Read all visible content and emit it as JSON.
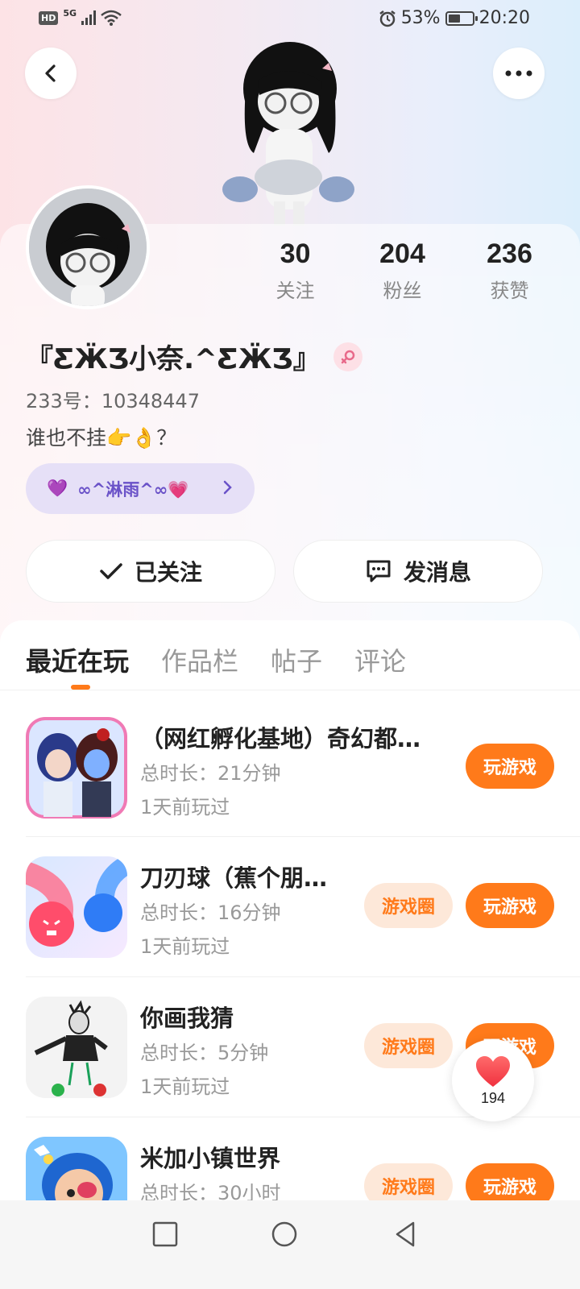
{
  "status_bar": {
    "hd": "HD",
    "network": "5G",
    "battery_percent": "53%",
    "battery_level": 0.53,
    "time": "20:20"
  },
  "profile": {
    "nickname": "『ƸӜƷ小奈.^ƸӜƷ』",
    "uid_label": "233号：",
    "uid": "10348447",
    "bio": "谁也不挂👉👌？",
    "tag": "∞^淋雨^∞💗",
    "tag_icon": "💜",
    "stats": [
      {
        "value": "30",
        "label": "关注"
      },
      {
        "value": "204",
        "label": "粉丝"
      },
      {
        "value": "236",
        "label": "获赞"
      }
    ]
  },
  "actions": {
    "follow_label": "已关注",
    "message_label": "发消息"
  },
  "tabs": [
    "最近在玩",
    "作品栏",
    "帖子",
    "评论"
  ],
  "games": [
    {
      "title": "（网红孵化基地）奇幻都…",
      "duration": "总时长：21分钟",
      "last_played": "1天前玩过",
      "has_circle": false
    },
    {
      "title": "刀刃球（蕉个朋…",
      "duration": "总时长：16分钟",
      "last_played": "1天前玩过",
      "has_circle": true
    },
    {
      "title": "你画我猜",
      "duration": "总时长：5分钟",
      "last_played": "1天前玩过",
      "has_circle": true
    },
    {
      "title": "米加小镇世界",
      "duration": "总时长：30小时",
      "last_played": "",
      "has_circle": true
    }
  ],
  "buttons": {
    "play": "玩游戏",
    "circle": "游戏圈"
  },
  "like_float": {
    "count": "194"
  },
  "colors": {
    "accent": "#ff7a1a",
    "accent_light": "#fde8d9",
    "tag_bg": "#e6e0f7",
    "tag_text": "#6a52c8"
  }
}
